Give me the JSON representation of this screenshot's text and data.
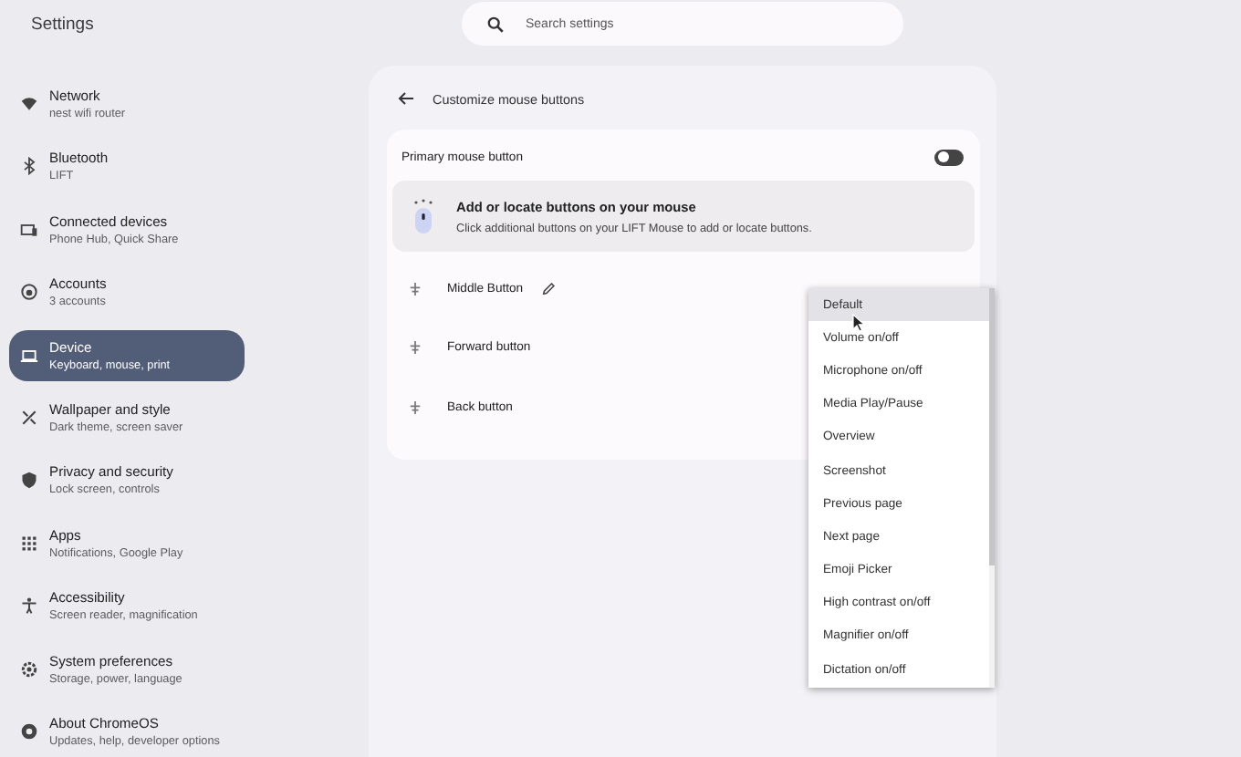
{
  "app": {
    "title": "Settings"
  },
  "search": {
    "placeholder": "Search settings"
  },
  "sidebar": {
    "items": [
      {
        "title": "Network",
        "subtitle": "nest wifi router",
        "selected": false
      },
      {
        "title": "Bluetooth",
        "subtitle": "LIFT",
        "selected": false
      },
      {
        "title": "Connected devices",
        "subtitle": "Phone Hub, Quick Share",
        "selected": false
      },
      {
        "title": "Accounts",
        "subtitle": "3 accounts",
        "selected": false
      },
      {
        "title": "Device",
        "subtitle": "Keyboard, mouse, print",
        "selected": true
      },
      {
        "title": "Wallpaper and style",
        "subtitle": "Dark theme, screen saver",
        "selected": false
      },
      {
        "title": "Privacy and security",
        "subtitle": "Lock screen, controls",
        "selected": false
      },
      {
        "title": "Apps",
        "subtitle": "Notifications, Google Play",
        "selected": false
      },
      {
        "title": "Accessibility",
        "subtitle": "Screen reader, magnification",
        "selected": false
      },
      {
        "title": "System preferences",
        "subtitle": "Storage, power, language",
        "selected": false
      },
      {
        "title": "About ChromeOS",
        "subtitle": "Updates, help, developer options",
        "selected": false
      }
    ]
  },
  "page": {
    "title": "Customize mouse buttons",
    "primary_button": {
      "label": "Primary mouse button",
      "on": false
    },
    "info": {
      "title": "Add or locate buttons on your mouse",
      "text": "Click additional buttons on your LIFT Mouse to add or locate buttons."
    },
    "buttons": [
      {
        "label": "Middle Button",
        "editable": true
      },
      {
        "label": "Forward button",
        "editable": false
      },
      {
        "label": "Back button",
        "editable": false
      }
    ]
  },
  "menu": {
    "items": [
      {
        "label": "Default",
        "selected": true
      },
      {
        "label": "Volume on/off",
        "selected": false
      },
      {
        "label": "Microphone on/off",
        "selected": false
      },
      {
        "label": "Media Play/Pause",
        "selected": false
      },
      {
        "label": "Overview",
        "selected": false
      },
      {
        "label": "Screenshot",
        "selected": false
      },
      {
        "label": "Previous page",
        "selected": false
      },
      {
        "label": "Next page",
        "selected": false
      },
      {
        "label": "Emoji Picker",
        "selected": false
      },
      {
        "label": "High contrast on/off",
        "selected": false
      },
      {
        "label": "Magnifier on/off",
        "selected": false
      },
      {
        "label": "Dictation on/off",
        "selected": false
      }
    ]
  }
}
